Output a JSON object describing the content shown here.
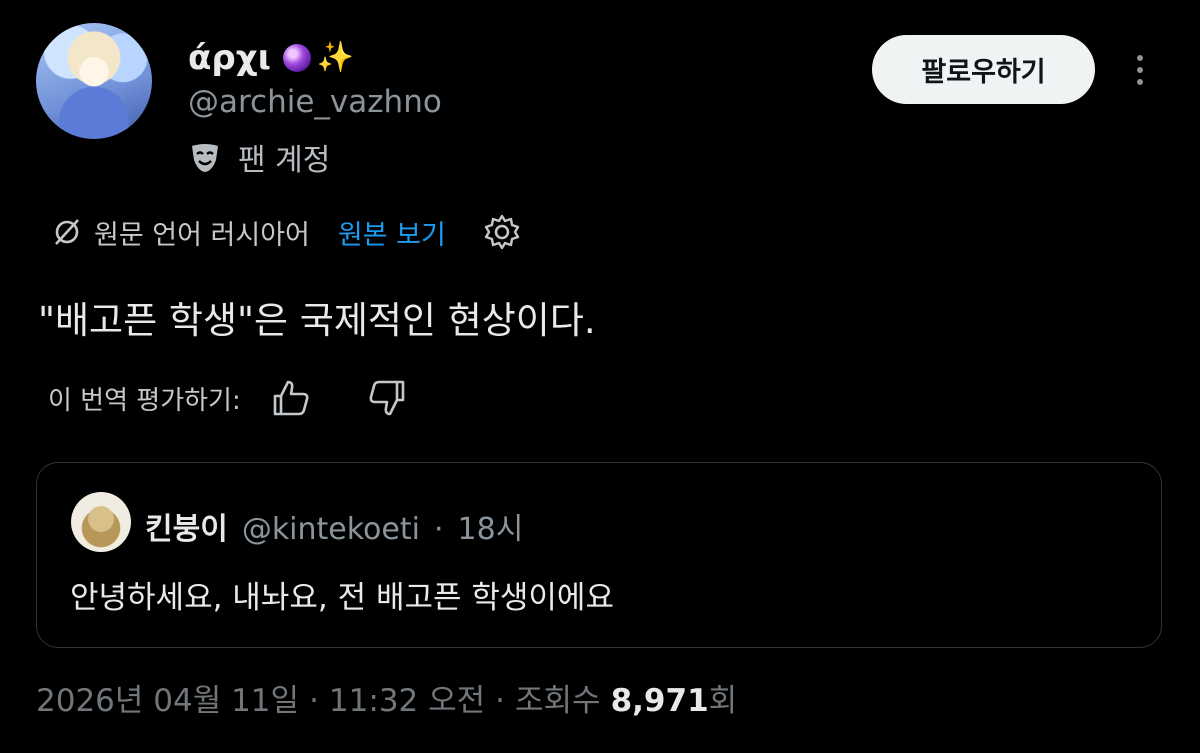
{
  "author": {
    "display_name": "άρχι",
    "handle": "@archie_vazhno",
    "badge_label": "팬 계정"
  },
  "follow_button": "팔로우하기",
  "translation": {
    "source_label": "원문 언어 러시아어",
    "view_original": "원본 보기"
  },
  "tweet_text": "\"배고픈 학생\"은 국제적인 현상이다.",
  "rate_label": "이 번역 평가하기:",
  "quote": {
    "name": "킨붕이",
    "handle": "@kintekoeti",
    "separator": "·",
    "time": "18시",
    "text": "안녕하세요, 내놔요, 전 배고픈 학생이에요"
  },
  "meta": {
    "date": "2026년 04월 11일",
    "sep1": "·",
    "time": "11:32 오전",
    "sep2": "·",
    "views_label": "조회수",
    "views_count": "8,971",
    "views_suffix": "회"
  },
  "colors": {
    "background": "#000000",
    "link": "#1d9bf0",
    "muted": "#71767b",
    "button_bg": "#eff3f4"
  }
}
